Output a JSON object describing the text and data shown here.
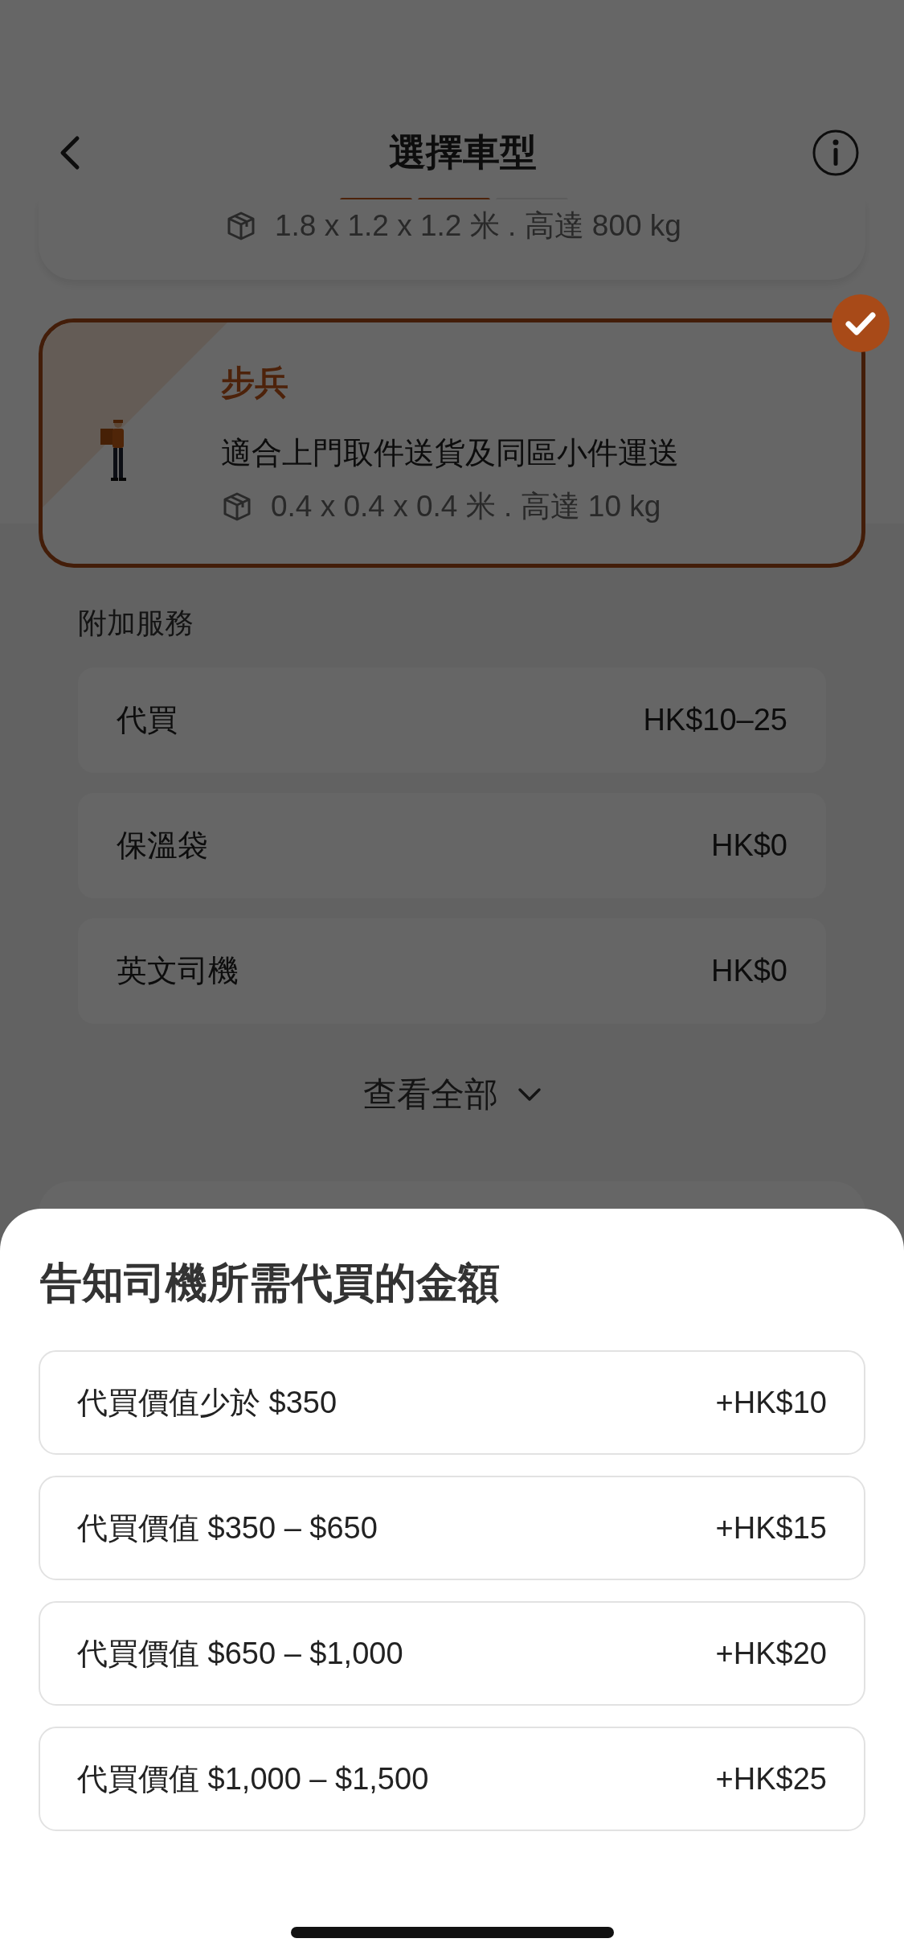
{
  "header": {
    "title": "選擇車型",
    "steps": [
      {
        "completed": true
      },
      {
        "completed": true
      },
      {
        "completed": false
      }
    ]
  },
  "vehicles": [
    {
      "kind": "partial",
      "spec": "1.8 x 1.2 x 1.2 米 . 高達 800 kg",
      "selected": false
    },
    {
      "kind": "full",
      "name": "步兵",
      "description": "適合上門取件送貨及同區小件運送",
      "spec": "0.4 x 0.4 x 0.4 米 . 高達 10 kg",
      "selected": true
    }
  ],
  "addons": {
    "title": "附加服務",
    "items": [
      {
        "name": "代買",
        "price": "HK$10–25"
      },
      {
        "name": "保溫袋",
        "price": "HK$0"
      },
      {
        "name": "英文司機",
        "price": "HK$0"
      }
    ],
    "view_all": "查看全部"
  },
  "sheet": {
    "title": "告知司機所需代買的金額",
    "options": [
      {
        "label": "代買價值少於 $350",
        "price": "+HK$10"
      },
      {
        "label": "代買價值 $350 – $650",
        "price": "+HK$15"
      },
      {
        "label": "代買價值 $650 – $1,000",
        "price": "+HK$20"
      },
      {
        "label": "代買價值 $1,000 – $1,500",
        "price": "+HK$25"
      }
    ]
  }
}
